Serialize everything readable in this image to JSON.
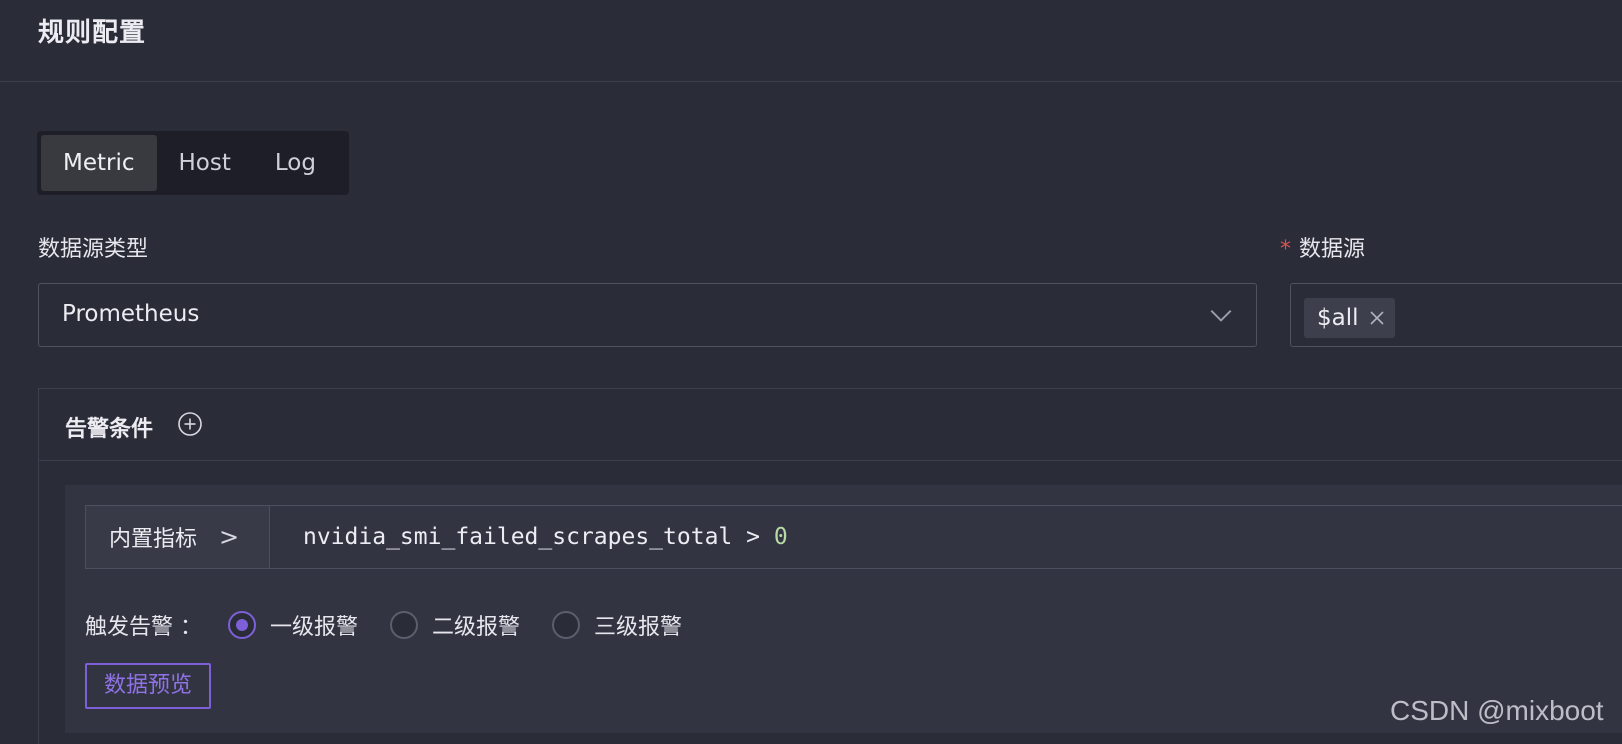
{
  "header": {
    "title": "规则配置"
  },
  "tabs": [
    {
      "label": "Metric",
      "active": true
    },
    {
      "label": "Host",
      "active": false
    },
    {
      "label": "Log",
      "active": false
    }
  ],
  "datasource_type": {
    "label": "数据源类型",
    "value": "Prometheus",
    "icon": "chevron-down-icon"
  },
  "datasource": {
    "required_mark": "*",
    "label": "数据源",
    "tags": [
      {
        "label": "$all",
        "icon": "close-icon"
      }
    ]
  },
  "alert_conditions": {
    "title": "告警条件",
    "add_icon": "plus-circle-icon",
    "query_prefix": "内置指标",
    "query_prefix_arrow": ">",
    "query_expr": "nvidia_smi_failed_scrapes_total > ",
    "query_value": "0",
    "trigger_label": "触发告警 ：",
    "levels": [
      {
        "label": "一级报警",
        "checked": true
      },
      {
        "label": "二级报警",
        "checked": false
      },
      {
        "label": "三级报警",
        "checked": false
      }
    ],
    "preview_button": "数据预览"
  },
  "colors": {
    "background": "#2a2c38",
    "accent": "#7d5fd8",
    "required": "#d9534f"
  },
  "watermark": "CSDN @mixboot"
}
